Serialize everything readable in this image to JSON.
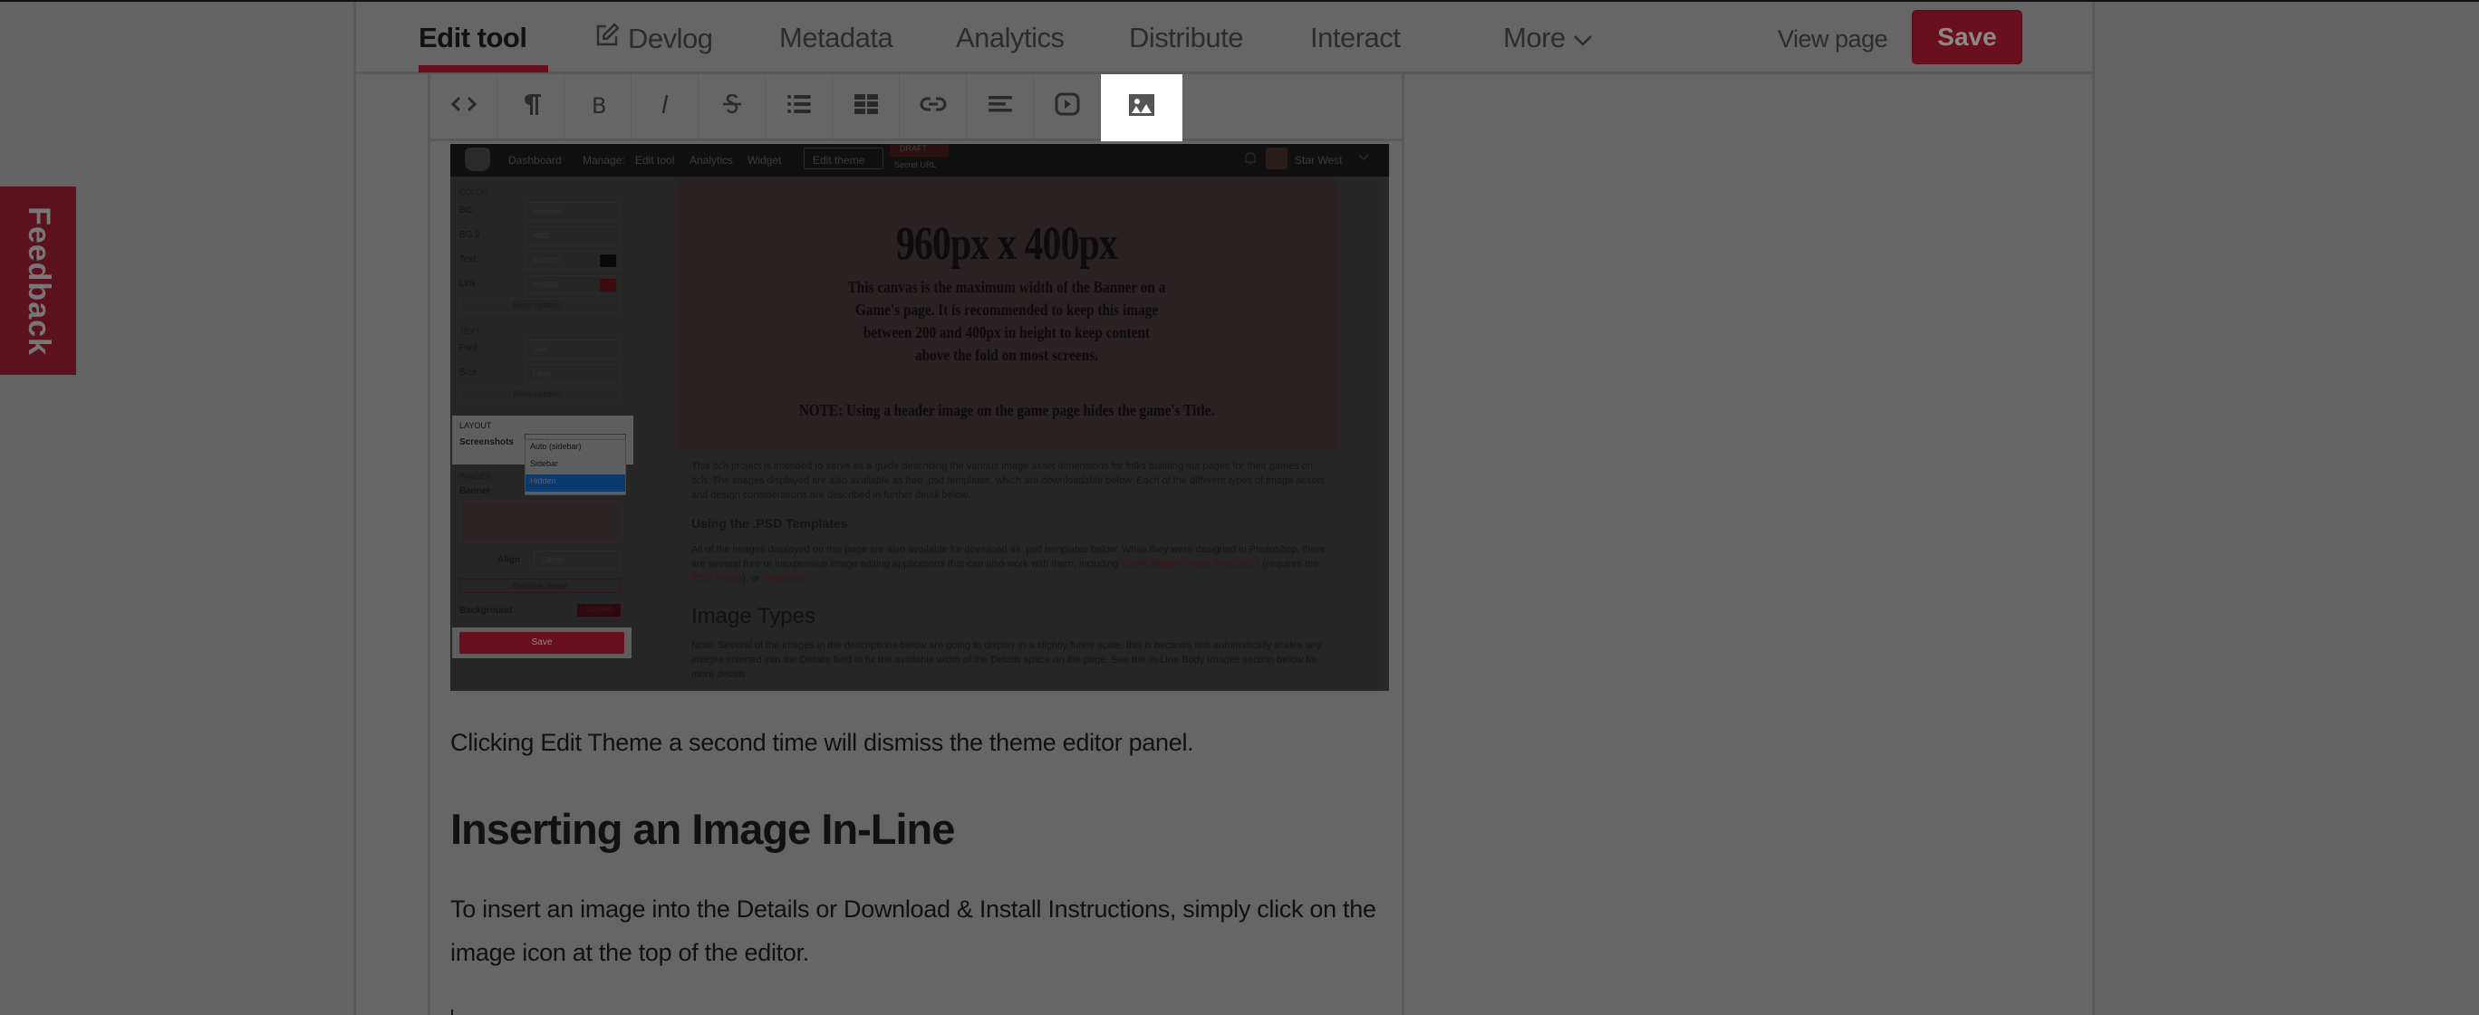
{
  "nav": {
    "tabs": [
      {
        "label": "Edit tool",
        "active": true
      },
      {
        "label": "Devlog",
        "icon": "edit-icon"
      },
      {
        "label": "Metadata"
      },
      {
        "label": "Analytics"
      },
      {
        "label": "Distribute"
      },
      {
        "label": "Interact"
      },
      {
        "label": "More",
        "icon": "chevron-down-icon"
      }
    ],
    "view_page": "View page",
    "save": "Save"
  },
  "toolbar": {
    "buttons": [
      {
        "name": "source-code",
        "icon": "code-icon"
      },
      {
        "name": "paragraph-format",
        "icon": "paragraph-icon"
      },
      {
        "name": "bold",
        "icon": "bold-icon"
      },
      {
        "name": "italic",
        "icon": "italic-icon"
      },
      {
        "name": "strikethrough",
        "icon": "strikethrough-icon"
      },
      {
        "name": "bulleted-list",
        "icon": "list-icon"
      },
      {
        "name": "table",
        "icon": "table-icon"
      },
      {
        "name": "link",
        "icon": "link-icon"
      },
      {
        "name": "align",
        "icon": "align-icon"
      },
      {
        "name": "embed-video",
        "icon": "video-icon"
      },
      {
        "name": "insert-image",
        "icon": "image-icon",
        "highlighted": true
      }
    ]
  },
  "screenshot": {
    "topbar": {
      "dashboard": "Dashboard",
      "manage": "Manage:",
      "edit_tool": "Edit tool",
      "analytics": "Analytics",
      "widget": "Widget",
      "edit_theme": "Edit theme",
      "draft": "DRAFT",
      "secret_url": "Secret URL",
      "user": "Star West"
    },
    "theme_panel": {
      "color_section": "COLOR",
      "colors": [
        {
          "label": "BG",
          "value": "#eeeeee"
        },
        {
          "label": "BG 2",
          "value": "#ffffff"
        },
        {
          "label": "Text",
          "value": "#222222",
          "swatch": "#0a0a0a"
        },
        {
          "label": "Link",
          "value": "#fa5c5c",
          "swatch": "#3a0c0c"
        }
      ],
      "more_options": "More options...",
      "text_section": "TEXT",
      "font_label": "Font",
      "font_value": "Lato",
      "size_label": "Size",
      "size_value": "Large",
      "layout_section": "LAYOUT",
      "screenshots_label": "Screenshots",
      "screenshots_value": "Hidden",
      "screenshots_options": [
        "Auto (sidebar)",
        "Sidebar",
        "Hidden"
      ],
      "images_section": "IMAGES",
      "banner_label": "Banner",
      "align_label": "Align",
      "align_value": "Center",
      "remove_image": "Remove image",
      "background_label": "Background",
      "upload": "Upload",
      "save": "Save"
    },
    "banner": {
      "title": "960px x 400px",
      "body": "This canvas is the maximum width of the  Banner on a Game's page. It is recommended to keep this image between 200 and 400px in height to keep content above the fold on most screens.",
      "note": "NOTE: Using a header image on the game page hides the game's Title."
    },
    "intro": "This itch project is intended to serve as a guide describing the various image asset dimensions for folks building out pages for their games on itch. The images displayed are also available as free .psd templates, which are downloadable below. Each of the different types of image assets and design considerations are described in further detail below.",
    "psd_heading": "Using the .PSD Templates",
    "psd_text_pre": "All of the images displayed on this page are also available for download as .psd templates below. While they were designed in Photoshop, there are several free or inexpensive image editing applications that can also work with them, including ",
    "psd_links": [
      "GIMP",
      "Affinity Photo",
      "Paint.NET",
      "PSD Plugin",
      "Photopea"
    ],
    "image_types_heading": "Image Types",
    "image_types_text": "Note: Several of the images in the descriptions below are going to display in a slightly funny scale, this is because itch automatically scales any images inserted into the Details field to fix the available width of the Details space on the page. See the In-Line Body Images section below for more details."
  },
  "content": {
    "para1": "Clicking Edit Theme a second time will dismiss the theme editor panel.",
    "heading": "Inserting an Image In-Line",
    "para2": "To insert an image into the Details or Download & Install Instructions, simply click on the image icon at the top of the editor."
  },
  "feedback": "Feedback",
  "colors": {
    "accent": "#6a0f1e",
    "overlay_bg": "#646464",
    "highlight": "#ffffff"
  }
}
